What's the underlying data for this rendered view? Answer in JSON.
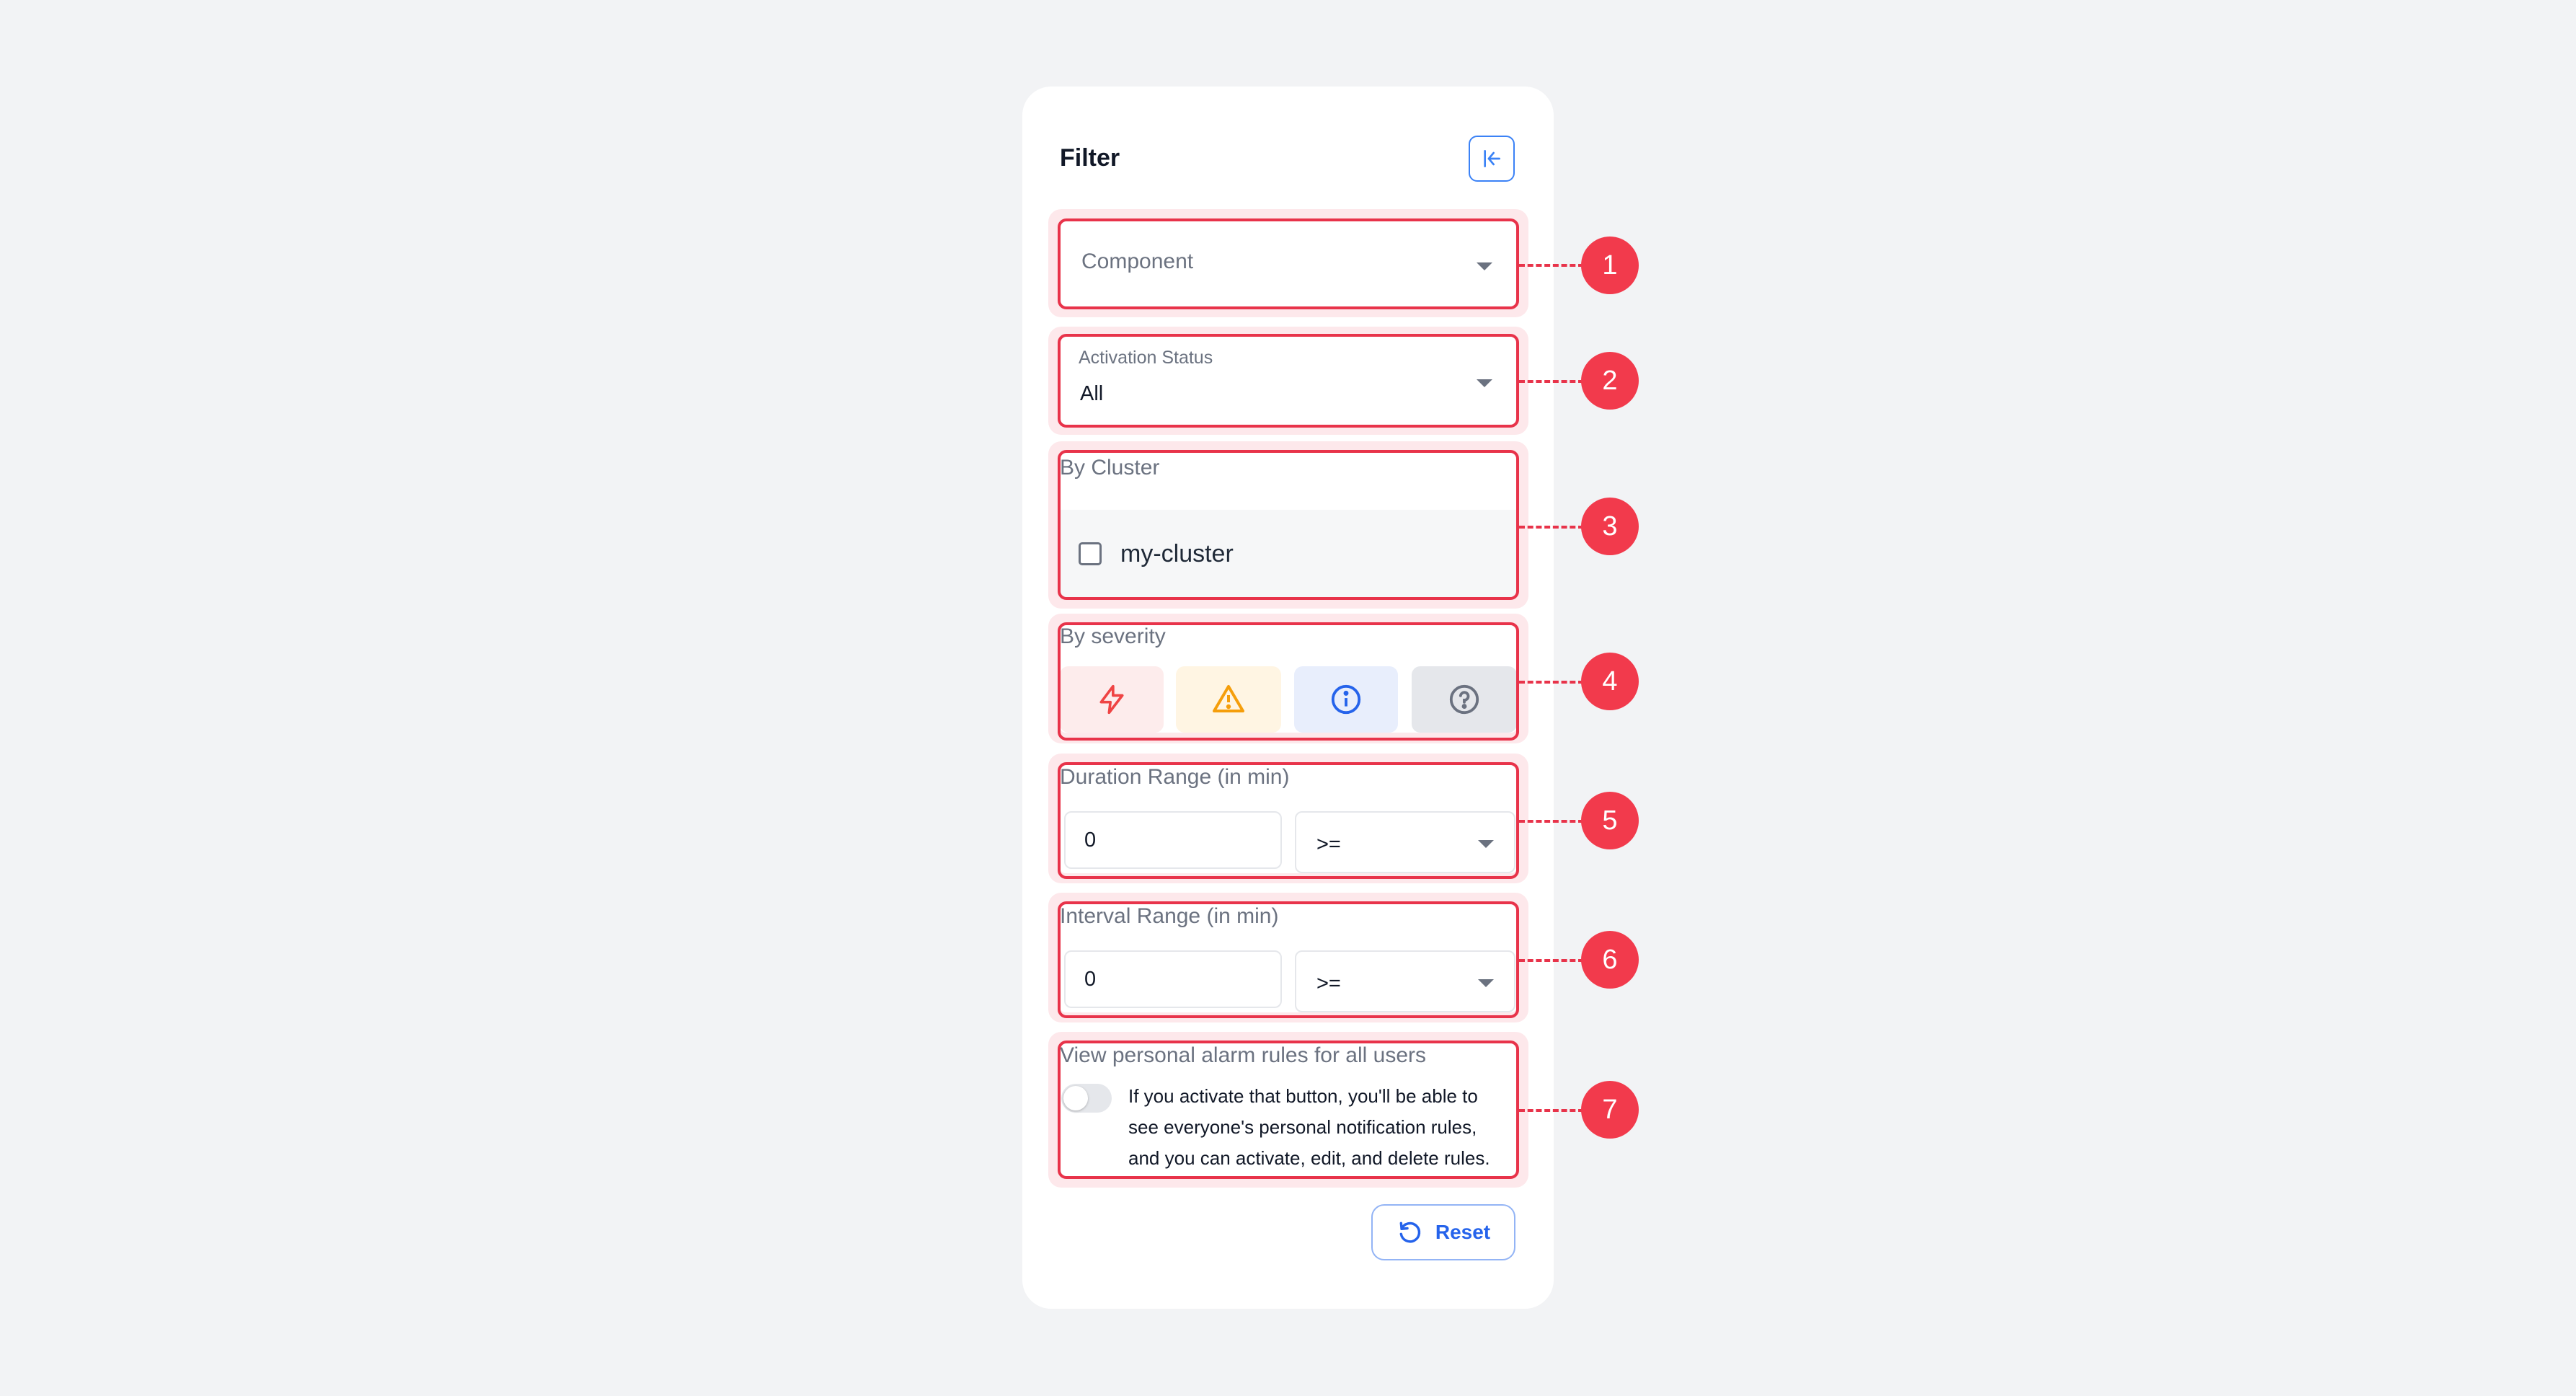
{
  "filter": {
    "title": "Filter",
    "collapse_icon": "collapse-left-icon",
    "component": {
      "placeholder": "Component"
    },
    "activation_status": {
      "label": "Activation Status",
      "value": "All"
    },
    "by_cluster": {
      "label": "By Cluster",
      "items": [
        {
          "label": "my-cluster",
          "checked": false
        }
      ]
    },
    "by_severity": {
      "label": "By severity",
      "levels": [
        {
          "icon": "lightning-icon",
          "color": "#ef4444",
          "bg": "#fdecec"
        },
        {
          "icon": "warning-triangle-icon",
          "color": "#f59e0b",
          "bg": "#fff5e3"
        },
        {
          "icon": "info-icon",
          "color": "#2563eb",
          "bg": "#e8eefc"
        },
        {
          "icon": "question-icon",
          "color": "#6b7280",
          "bg": "#e5e7eb"
        }
      ]
    },
    "duration_range": {
      "label": "Duration Range (in min)",
      "value": "0",
      "operator": ">="
    },
    "interval_range": {
      "label": "Interval Range (in min)",
      "value": "0",
      "operator": ">="
    },
    "personal_rules": {
      "label": "View personal alarm rules for all users",
      "enabled": false,
      "help_lines": [
        "If you activate that button, you'll be able to",
        "see everyone's personal notification rules,",
        "and you can activate, edit, and delete rules."
      ]
    },
    "reset_label": "Reset"
  },
  "annotations": [
    "1",
    "2",
    "3",
    "4",
    "5",
    "6",
    "7"
  ],
  "colors": {
    "accent": "#2563eb",
    "annotation": "#e8334a"
  }
}
